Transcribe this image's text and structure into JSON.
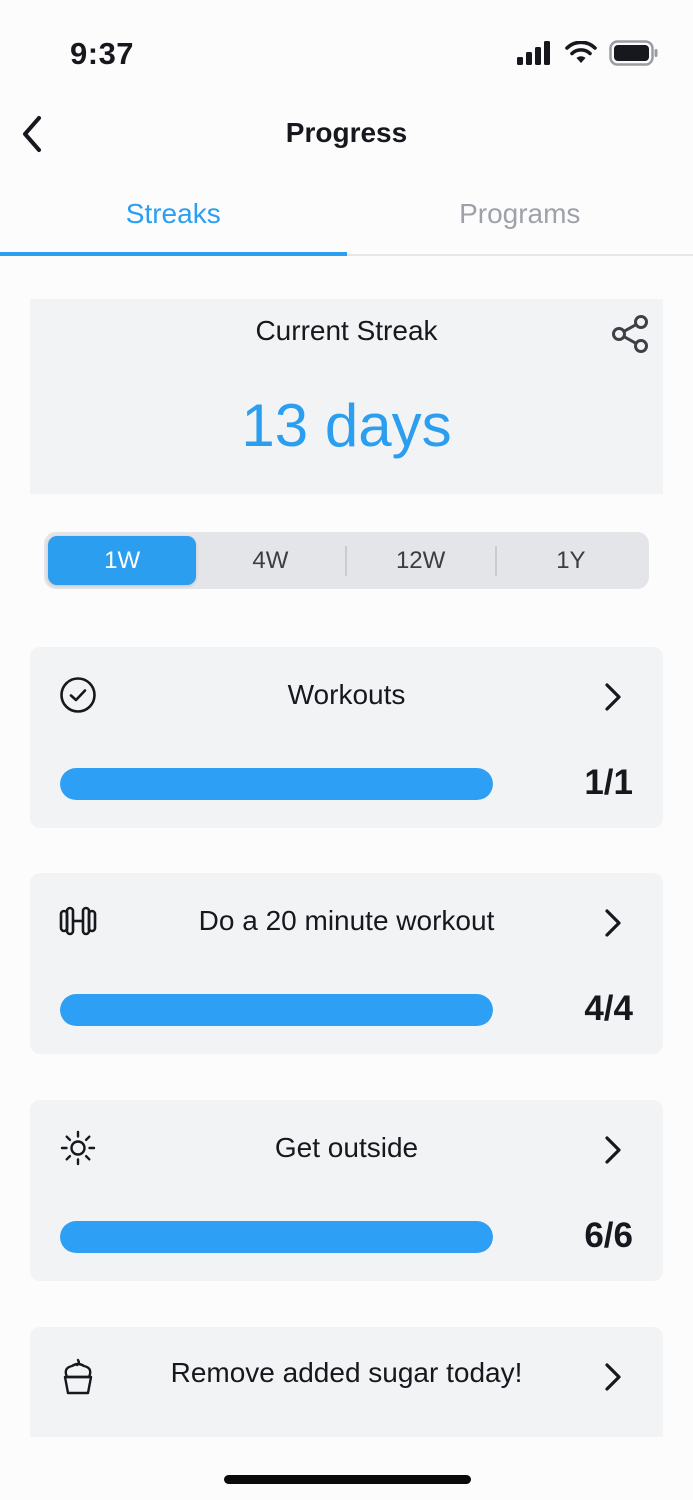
{
  "status_bar": {
    "time": "9:37",
    "icons": [
      "signal-icon",
      "wifi-icon",
      "battery-icon"
    ]
  },
  "header": {
    "title": "Progress",
    "back_icon": "chevron-left-icon"
  },
  "tabs": [
    {
      "label": "Streaks",
      "active": true
    },
    {
      "label": "Programs",
      "active": false
    }
  ],
  "streak": {
    "label": "Current Streak",
    "value": "13 days",
    "share_icon": "share-icon"
  },
  "range_selector": {
    "options": [
      "1W",
      "4W",
      "12W",
      "1Y"
    ],
    "selected": "1W"
  },
  "goals": [
    {
      "title": "Workouts",
      "icon": "check-circle-icon",
      "count": "1/1",
      "progress": 1.0
    },
    {
      "title": "Do a 20 minute workout",
      "icon": "dumbbell-icon",
      "count": "4/4",
      "progress": 1.0
    },
    {
      "title": "Get outside",
      "icon": "sun-icon",
      "count": "6/6",
      "progress": 1.0
    },
    {
      "title": "Remove added sugar today!",
      "icon": "cupcake-icon"
    }
  ],
  "colors": {
    "accent": "#2b9ef0",
    "card_background": "#f2f3f5",
    "inactive_tab": "#9ea1a8"
  }
}
